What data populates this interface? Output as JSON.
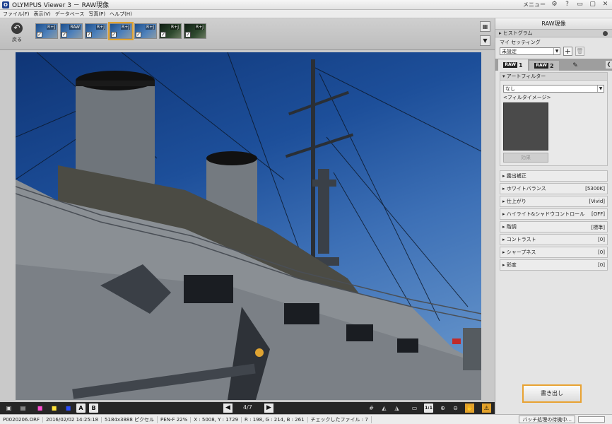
{
  "window": {
    "title": "OLYMPUS Viewer 3 － RAW現像",
    "menu_label": "メニュー",
    "logo_text": "O"
  },
  "menubar": {
    "items": [
      "ファイル(F)",
      "表示(V)",
      "データベース",
      "写真(P)",
      "ヘルプ(H)"
    ]
  },
  "filmstrip": {
    "back_label": "戻る",
    "thumbnails": [
      {
        "tag": "R+J",
        "checked": true
      },
      {
        "tag": "RAW",
        "checked": true
      },
      {
        "tag": "R+J",
        "checked": true
      },
      {
        "tag": "R+J",
        "checked": true,
        "selected": true
      },
      {
        "tag": "R+J",
        "checked": true
      },
      {
        "tag": "R+J",
        "checked": true
      },
      {
        "tag": "R+J",
        "checked": true
      }
    ]
  },
  "bottombar": {
    "pager": "4/7",
    "letter_a": "A",
    "letter_b": "B",
    "ratio_label": "1:1"
  },
  "statusbar": {
    "filename": "P0020206.ORF",
    "datetime": "2016/02/02  14:25:18",
    "size": "5184x3888 ピクセル",
    "camera": "PEN-F  22%",
    "coords": "X : 5008, Y : 1729",
    "rgb": "R : 198, G : 214, B : 261",
    "checked_files": "チェックしたファイル : 7",
    "batch_status": "バッチ処理の待機中..."
  },
  "panel": {
    "title": "RAW現像",
    "histogram_label": "ヒストグラム",
    "mysetting_label": "マイ セッティング",
    "mysetting_value": "未設定",
    "tab1_num": "1",
    "tab2_num": "2",
    "raw_badge": "RAW",
    "art_filter": {
      "header": "アートフィルター",
      "value": "なし",
      "image_label": "<フィルタイメージ>",
      "effect_button": "効果"
    },
    "properties": [
      {
        "label": "露出補正",
        "value": ""
      },
      {
        "label": "ホワイトバランス",
        "value": "[5300K]"
      },
      {
        "label": "仕上がり",
        "value": "[Vivid]"
      },
      {
        "label": "ハイライト&シャドウコントロール",
        "value": "[OFF]"
      },
      {
        "label": "階調",
        "value": "[標準]"
      },
      {
        "label": "コントラスト",
        "value": "[0]"
      },
      {
        "label": "シャープネス",
        "value": "[0]"
      },
      {
        "label": "彩度",
        "value": "[0]"
      }
    ],
    "write_button": "書き出し"
  },
  "colors": {
    "accent": "#e8a232",
    "sky": "#1d4f9a",
    "hull": "#8a8f94"
  }
}
